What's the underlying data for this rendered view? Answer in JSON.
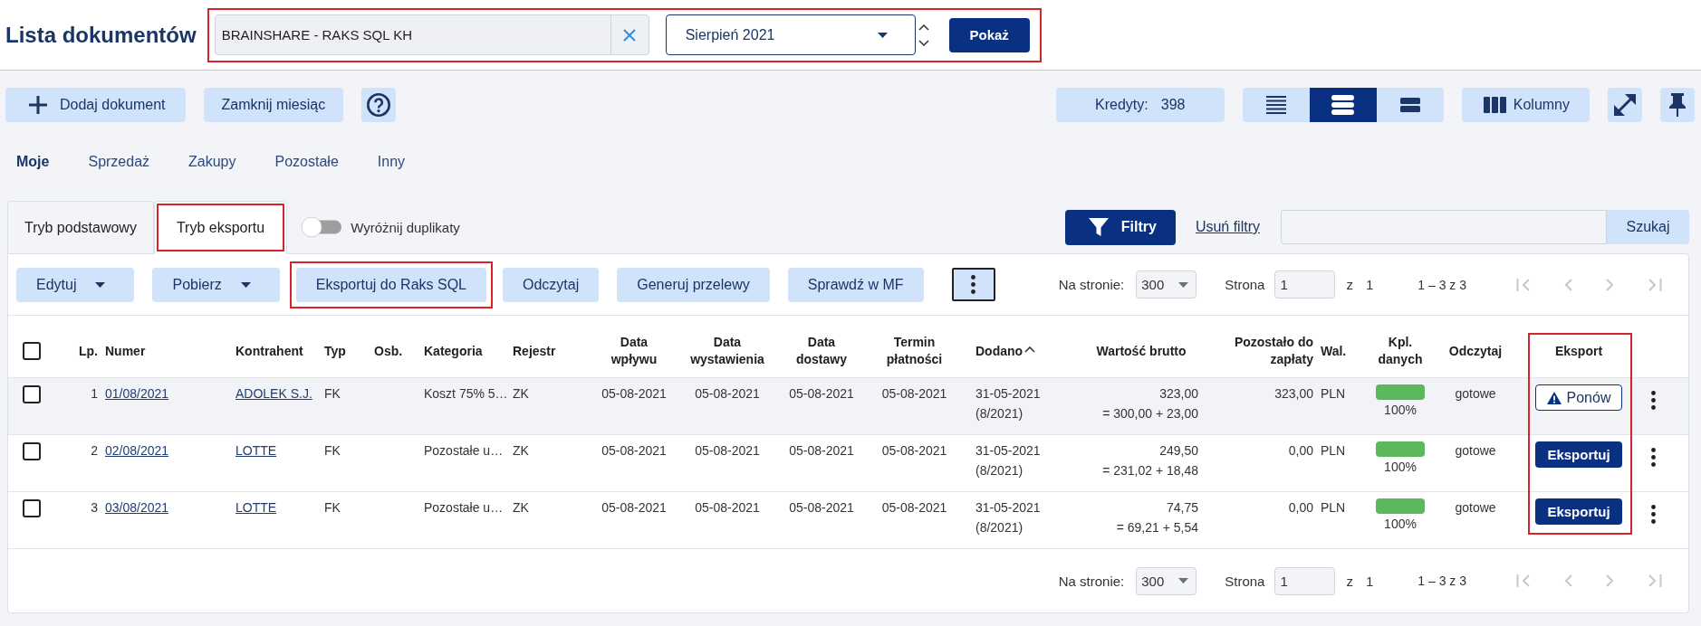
{
  "header": {
    "title": "Lista dokumentów",
    "filter": {
      "highlighted": true,
      "company": "BRAINSHARE - RAKS SQL KH",
      "month": "Sierpień 2021",
      "submit": "Pokaż"
    }
  },
  "toolbar": {
    "buttons": [
      {
        "kind": "add",
        "label": "Dodaj dokument"
      },
      {
        "kind": "plain",
        "label": "Zamknij miesiąc"
      },
      {
        "kind": "help"
      }
    ],
    "credits": {
      "label": "Kredyty:",
      "value": "398"
    },
    "view_modes": [
      {
        "kind": "dense",
        "selected": false
      },
      {
        "kind": "normal",
        "selected": true
      },
      {
        "kind": "wide",
        "selected": false
      }
    ],
    "columns_button": "Kolumny",
    "tools": [
      {
        "kind": "expand"
      },
      {
        "kind": "pin"
      }
    ]
  },
  "nav_tabs": [
    {
      "label": "Moje",
      "selected": true
    },
    {
      "label": "Sprzedaż",
      "selected": false
    },
    {
      "label": "Zakupy",
      "selected": false
    },
    {
      "label": "Pozostałe",
      "selected": false
    },
    {
      "label": "Inny",
      "selected": false
    }
  ],
  "mode_tabs": [
    {
      "label": "Tryb podstawowy",
      "selected": false,
      "highlighted": false
    },
    {
      "label": "Tryb eksportu",
      "selected": true,
      "highlighted": true
    }
  ],
  "duplicates_toggle": {
    "label": "Wyróżnij duplikaty",
    "on": false
  },
  "filters": {
    "button": "Filtry",
    "clear_link": "Usuń filtry",
    "search_button": "Szukaj"
  },
  "actions": [
    {
      "label": "Edytuj",
      "dropdown": true,
      "highlighted": false
    },
    {
      "label": "Pobierz",
      "dropdown": true,
      "highlighted": false
    },
    {
      "label": "Eksportuj do Raks SQL",
      "dropdown": false,
      "highlighted": true
    },
    {
      "label": "Odczytaj",
      "dropdown": false,
      "highlighted": false
    },
    {
      "label": "Generuj przelewy",
      "dropdown": false,
      "highlighted": false
    },
    {
      "label": "Sprawdź w MF",
      "dropdown": false,
      "highlighted": false
    }
  ],
  "pagination_top": {
    "per_page_label": "Na stronie:",
    "per_page": "300",
    "page_label": "Strona",
    "page": "1",
    "of_label": "z",
    "total_pages": "1",
    "range": "1 – 3 z 3",
    "nav": [
      {
        "kind": "first",
        "disabled": true
      },
      {
        "kind": "prev",
        "disabled": true
      },
      {
        "kind": "next",
        "disabled": true
      },
      {
        "kind": "last",
        "disabled": true
      }
    ]
  },
  "table": {
    "select_all": {
      "checked": false
    },
    "columns": [
      {
        "label": "Lp.",
        "sorted": false,
        "highlighted": false
      },
      {
        "label": "Numer",
        "sorted": false,
        "highlighted": false
      },
      {
        "label": "Kontrahent",
        "sorted": false,
        "highlighted": false
      },
      {
        "label": "Typ",
        "sorted": false,
        "highlighted": false
      },
      {
        "label": "Osb.",
        "sorted": false,
        "highlighted": false
      },
      {
        "label": "Kategoria",
        "sorted": false,
        "highlighted": false
      },
      {
        "label": "Rejestr",
        "sorted": false,
        "highlighted": false
      },
      {
        "label": "Data wpływu",
        "sorted": false,
        "highlighted": false
      },
      {
        "label": "Data wystawienia",
        "sorted": false,
        "highlighted": false
      },
      {
        "label": "Data dostawy",
        "sorted": false,
        "highlighted": false
      },
      {
        "label": "Termin płatności",
        "sorted": false,
        "highlighted": false
      },
      {
        "label": "Dodano",
        "sorted": true,
        "highlighted": false
      },
      {
        "label": "Wartość brutto",
        "sorted": false,
        "highlighted": false
      },
      {
        "label": "Pozostało do zapłaty",
        "sorted": false,
        "highlighted": false
      },
      {
        "label": "Wal.",
        "sorted": false,
        "highlighted": false
      },
      {
        "label": "Kpl. danych",
        "sorted": false,
        "highlighted": false
      },
      {
        "label": "Odczytaj",
        "sorted": false,
        "highlighted": false
      },
      {
        "label": "Eksport",
        "sorted": false,
        "highlighted": true
      }
    ],
    "rows": [
      {
        "checked": false,
        "hovered": true,
        "lp": "1",
        "number": "01/08/2021",
        "contractor": "ADOLEK S.J.",
        "type": "FK",
        "category": "Koszt 75% 5…",
        "register": "ZK",
        "received": "05-08-2021",
        "issued": "05-08-2021",
        "delivered": "05-08-2021",
        "due": "05-08-2021",
        "added": "31-05-2021",
        "added_period": "(8/2021)",
        "gross": "323,00",
        "gross_breakdown": "= 300,00 + 23,00",
        "remaining": "323,00",
        "currency": "PLN",
        "completeness": {
          "level": 1,
          "label": "100%"
        },
        "read_status": "gotowe",
        "export": {
          "kind": "retry",
          "label": "Ponów"
        }
      },
      {
        "checked": false,
        "hovered": false,
        "lp": "2",
        "number": "02/08/2021",
        "contractor": "LOTTE",
        "type": "FK",
        "category": "Pozostałe u…",
        "register": "ZK",
        "received": "05-08-2021",
        "issued": "05-08-2021",
        "delivered": "05-08-2021",
        "due": "05-08-2021",
        "added": "31-05-2021",
        "added_period": "(8/2021)",
        "gross": "249,50",
        "gross_breakdown": "= 231,02 + 18,48",
        "remaining": "0,00",
        "currency": "PLN",
        "completeness": {
          "level": 1,
          "label": "100%"
        },
        "read_status": "gotowe",
        "export": {
          "kind": "export",
          "label": "Eksportuj"
        }
      },
      {
        "checked": false,
        "hovered": false,
        "lp": "3",
        "number": "03/08/2021",
        "contractor": "LOTTE",
        "type": "FK",
        "category": "Pozostałe u…",
        "register": "ZK",
        "received": "05-08-2021",
        "issued": "05-08-2021",
        "delivered": "05-08-2021",
        "due": "05-08-2021",
        "added": "31-05-2021",
        "added_period": "(8/2021)",
        "gross": "74,75",
        "gross_breakdown": "= 69,21 + 5,54",
        "remaining": "0,00",
        "currency": "PLN",
        "completeness": {
          "level": 1,
          "label": "100%"
        },
        "read_status": "gotowe",
        "export": {
          "kind": "export",
          "label": "Eksportuj"
        }
      }
    ]
  },
  "pagination_bottom": {
    "per_page_label": "Na stronie:",
    "per_page": "300",
    "page_label": "Strona",
    "page": "1",
    "of_label": "z",
    "total_pages": "1",
    "range": "1 – 3 z 3",
    "nav": [
      {
        "kind": "first",
        "disabled": true
      },
      {
        "kind": "prev",
        "disabled": true
      },
      {
        "kind": "next",
        "disabled": true
      },
      {
        "kind": "last",
        "disabled": true
      }
    ]
  }
}
